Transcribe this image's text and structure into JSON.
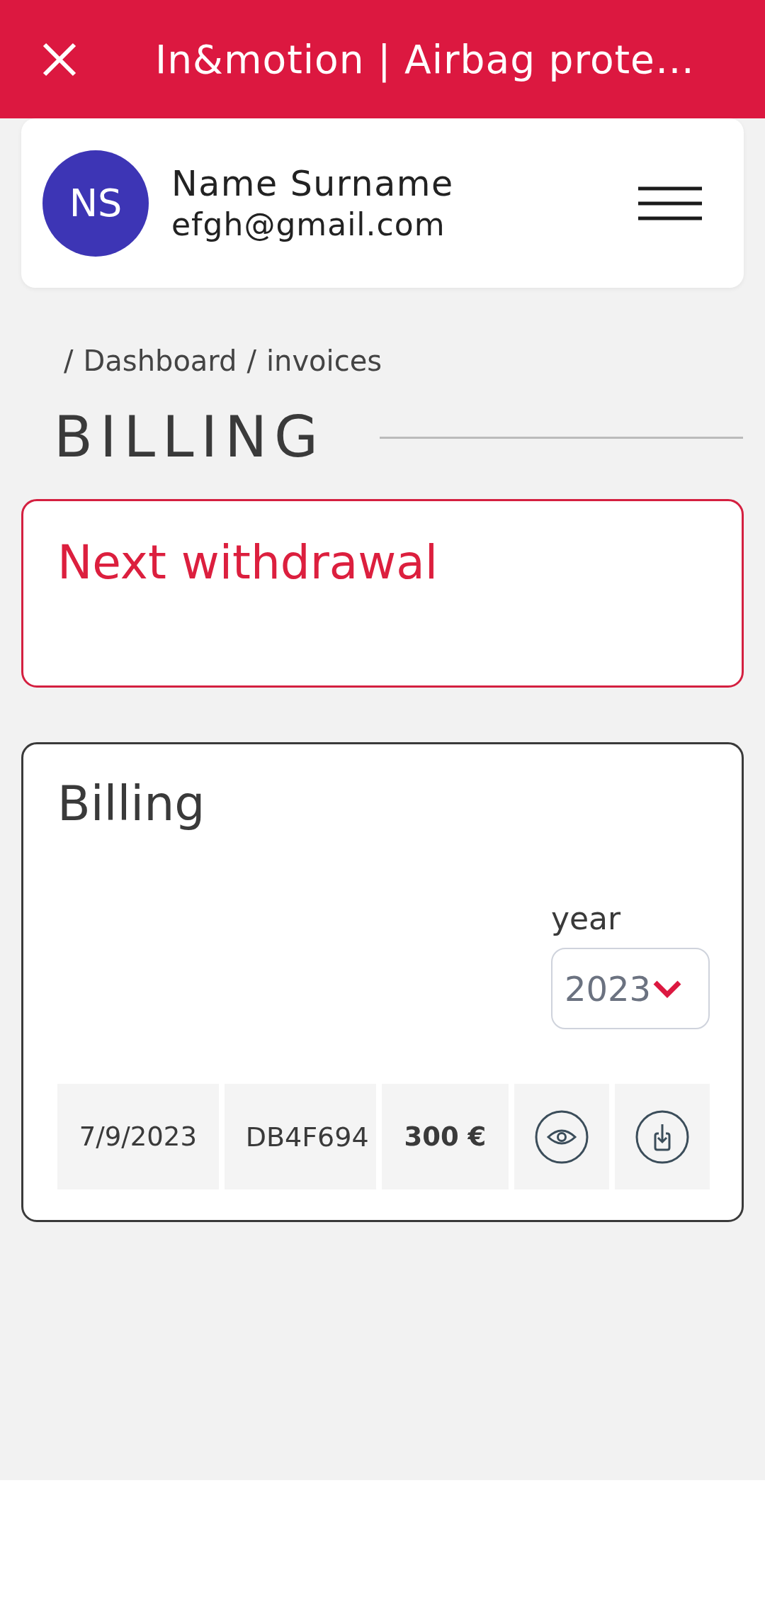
{
  "top_bar": {
    "title": "In&motion | Airbag prote…"
  },
  "profile": {
    "initials": "NS",
    "name": "Name Surname",
    "email": "efgh@gmail.com"
  },
  "breadcrumb": [
    {
      "separator": "/",
      "label": "Dashboard"
    },
    {
      "separator": "/",
      "label": "invoices"
    }
  ],
  "page_heading": "BILLING",
  "next_withdrawal": {
    "title": "Next withdrawal"
  },
  "billing": {
    "title": "Billing",
    "year_filter": {
      "label": "year",
      "value": "2023"
    },
    "invoices": [
      {
        "date": "7/9/2023",
        "reference": "DB4F694",
        "amount": "300 €"
      }
    ]
  }
}
